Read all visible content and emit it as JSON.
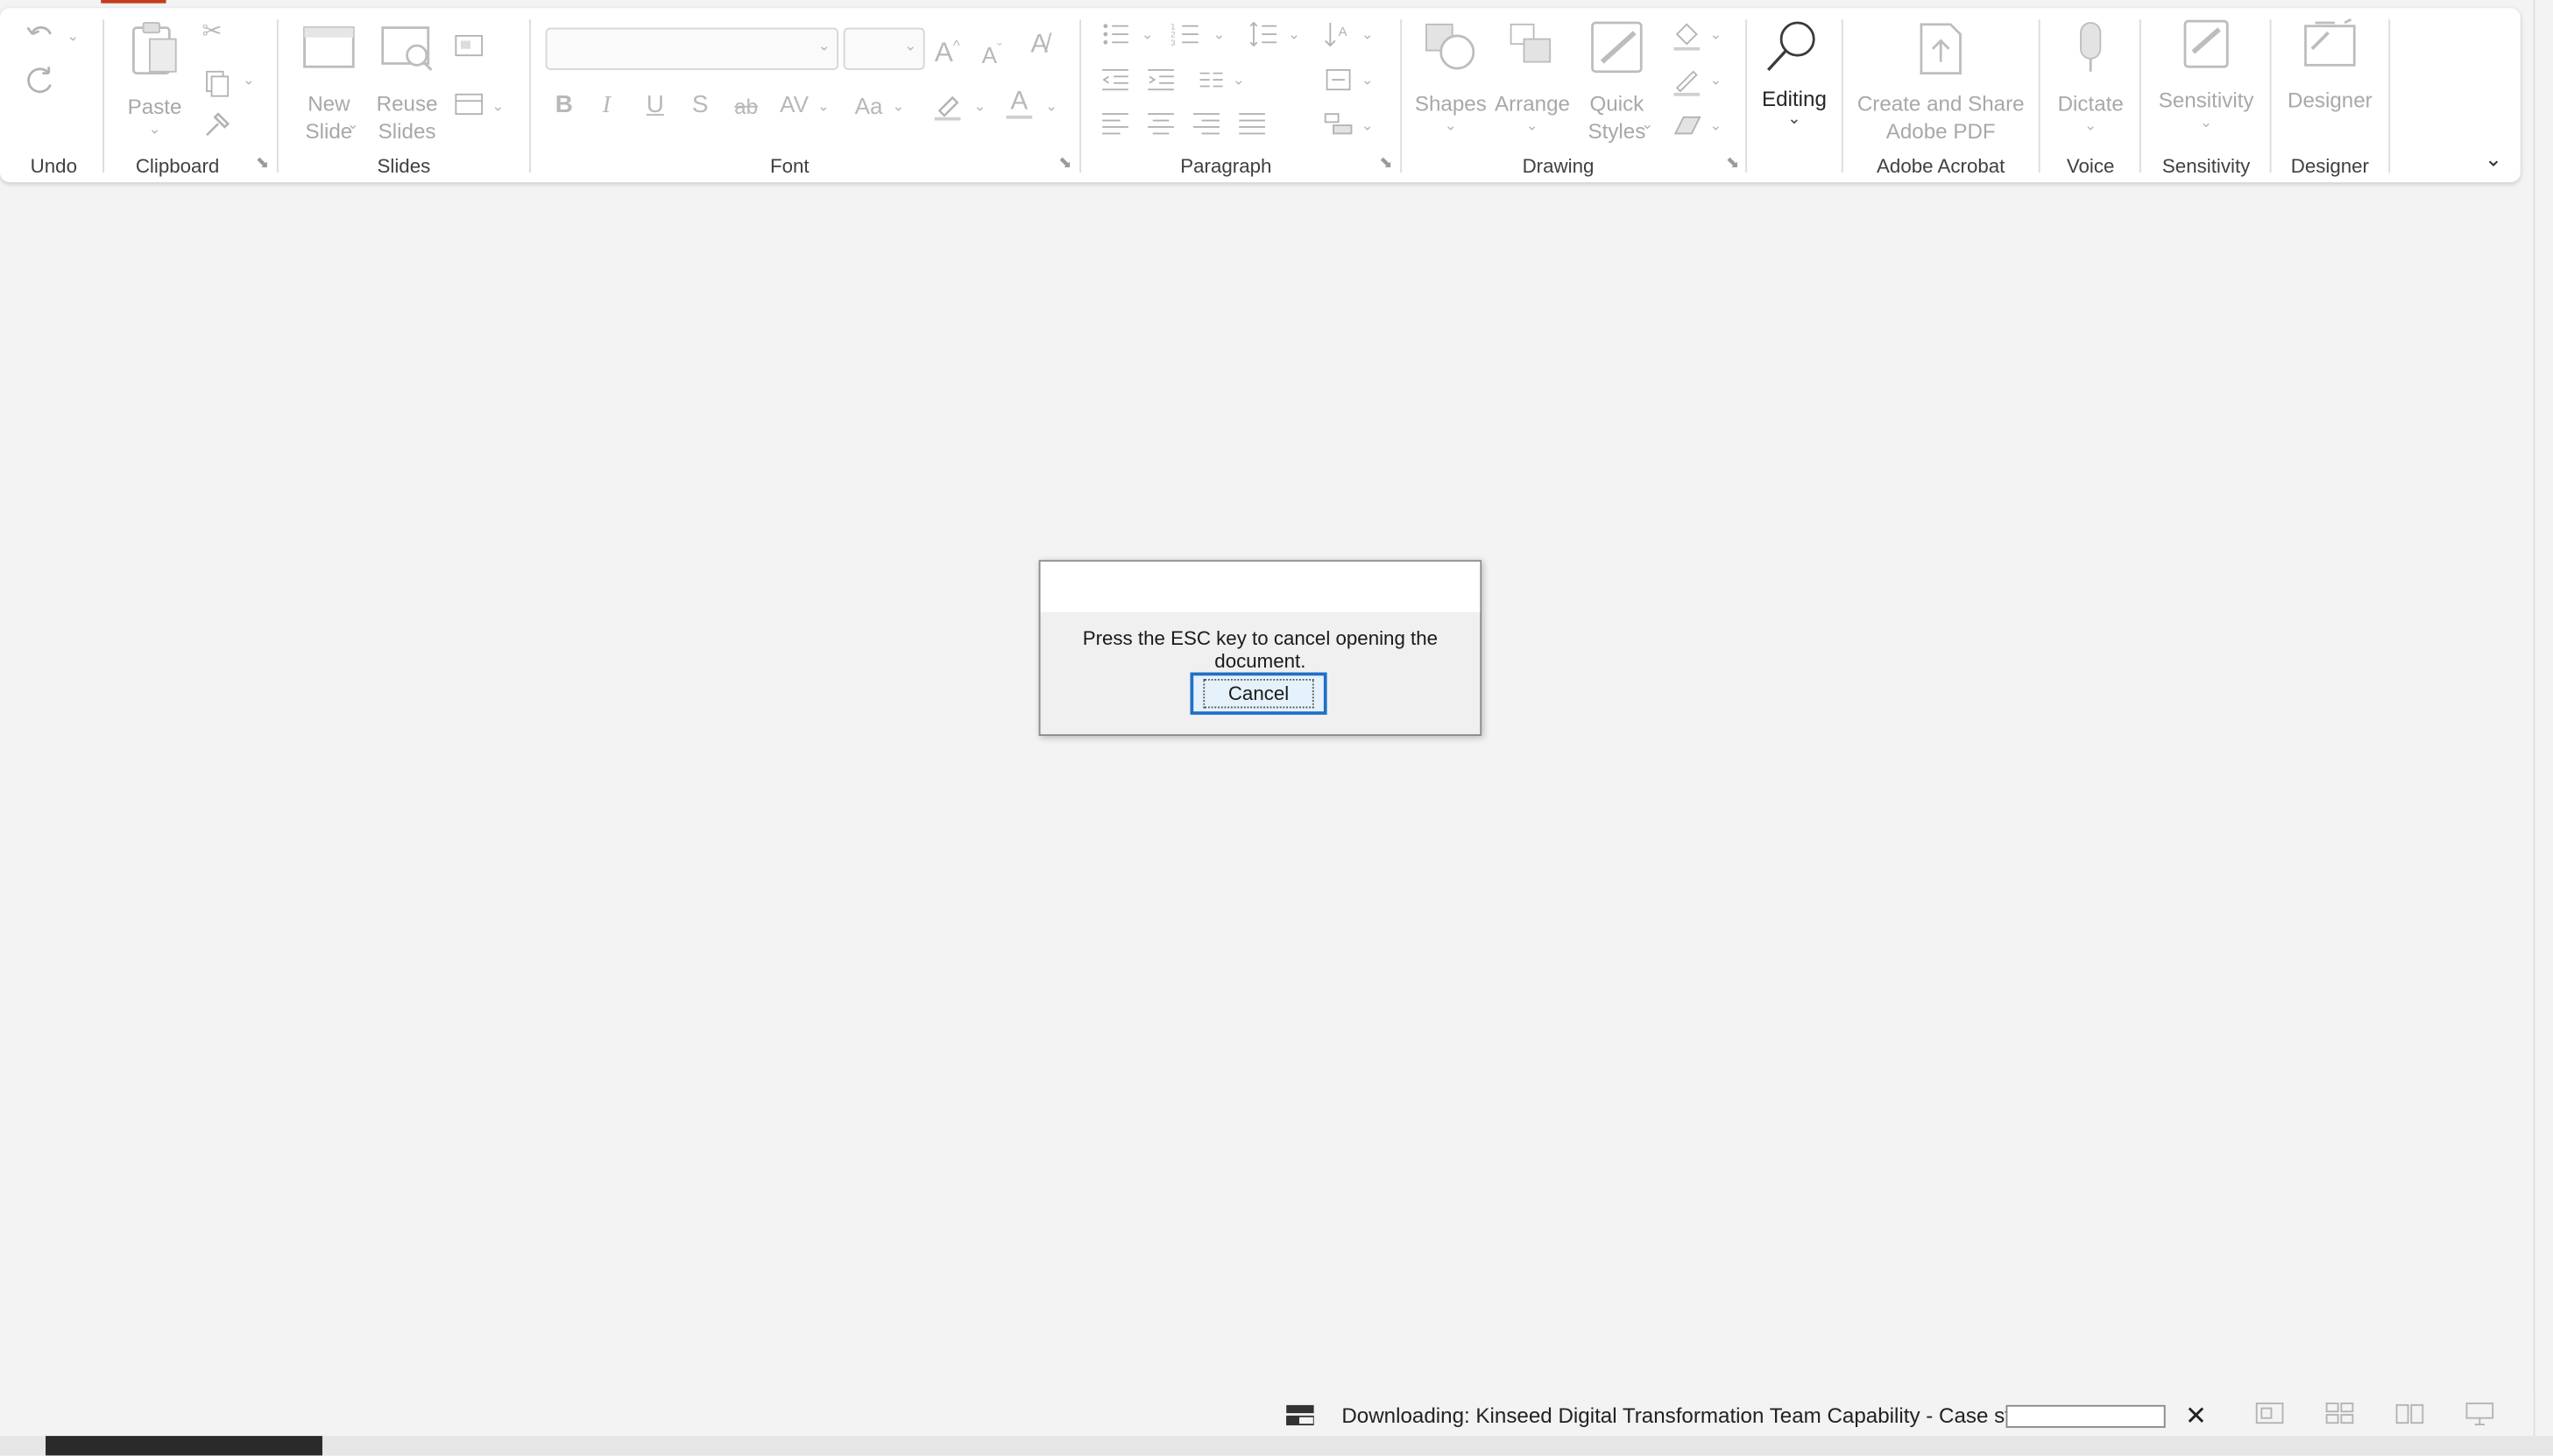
{
  "ribbon": {
    "groups": {
      "undo": "Undo",
      "clipboard": "Clipboard",
      "slides": "Slides",
      "font": "Font",
      "paragraph": "Paragraph",
      "drawing": "Drawing",
      "adobe": "Adobe Acrobat",
      "voice": "Voice",
      "sensitivity": "Sensitivity",
      "designer": "Designer"
    },
    "buttons": {
      "paste": "Paste",
      "new_slide_1": "New",
      "new_slide_2": "Slide",
      "reuse_slides_1": "Reuse",
      "reuse_slides_2": "Slides",
      "shapes": "Shapes",
      "arrange": "Arrange",
      "quick_styles_1": "Quick",
      "quick_styles_2": "Styles",
      "editing": "Editing",
      "create_share_1": "Create and Share",
      "create_share_2": "Adobe PDF",
      "dictate": "Dictate",
      "sensitivity": "Sensitivity",
      "designer": "Designer"
    },
    "font": {
      "bold": "B",
      "italic": "I",
      "underline": "U",
      "shadow": "S",
      "strike": "ab",
      "spacing": "AV",
      "case": "Aa",
      "grow": "A",
      "shrink": "A",
      "color": "A"
    }
  },
  "dialog": {
    "message": "Press the ESC key to cancel opening the document.",
    "cancel": "Cancel"
  },
  "status": {
    "download": "Downloading: Kinseed Digital Transformation Team Capability - Case studies.pptx"
  }
}
